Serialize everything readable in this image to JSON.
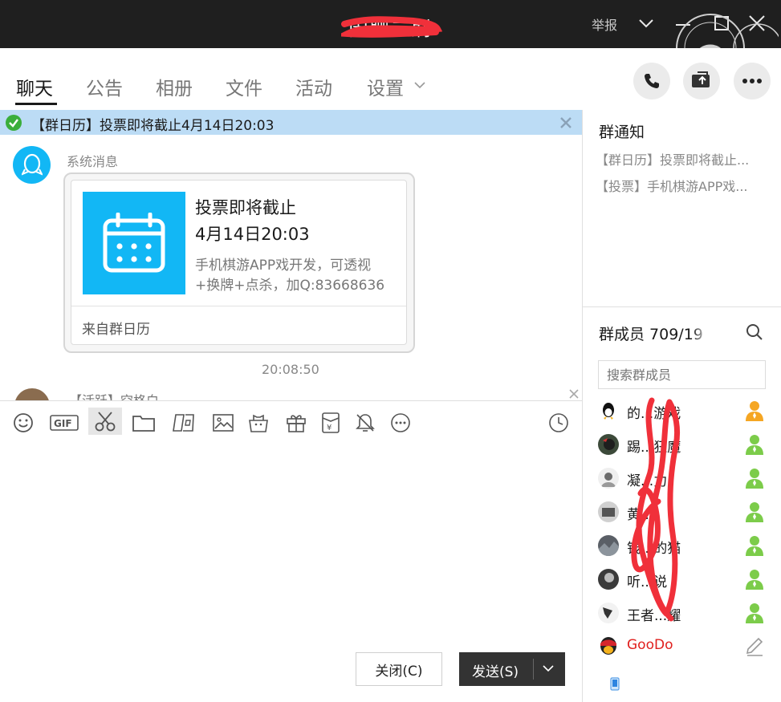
{
  "window": {
    "title": "闲聊二刷",
    "report_label": "举报",
    "window_icons": [
      "chevron-down-icon",
      "minimize-icon",
      "maximize-icon",
      "close-icon"
    ]
  },
  "tabs": [
    {
      "label": "聊天",
      "active": true
    },
    {
      "label": "公告"
    },
    {
      "label": "相册"
    },
    {
      "label": "文件"
    },
    {
      "label": "活动"
    },
    {
      "label": "设置"
    }
  ],
  "header_actions": [
    "phone-icon",
    "share-screen-icon",
    "more-icon"
  ],
  "notice_bar": {
    "text": "【群日历】投票即将截止4月14日20:03"
  },
  "chat": {
    "system_sender": "系统消息",
    "card": {
      "title": "投票即将截止",
      "time": "4月14日20:03",
      "desc_line1": "手机棋游APP戏开发，可透视",
      "desc_line2": "+换牌+点杀，加Q:83668636",
      "source": "来自群日历"
    },
    "message_time": "20:08:50",
    "peek_text": "【活跃】空格白"
  },
  "toolbar": {
    "icons": [
      "emoji-icon",
      "gif-icon",
      "scissors-icon",
      "folder-icon",
      "tiles-icon",
      "image-icon",
      "bag-icon",
      "gift-icon",
      "red-packet-icon",
      "bell-mute-icon",
      "more-circle-icon",
      "clock-icon"
    ],
    "active": "scissors-icon"
  },
  "buttons": {
    "close_label": "关闭(C)",
    "send_label": "发送(S)"
  },
  "right_panel": {
    "notice_title": "群通知",
    "notices": [
      "【群日历】投票即将截止...",
      "【投票】手机棋游APP戏..."
    ],
    "members_title": "群成员 709/19",
    "search_placeholder": "搜索群成员",
    "members": [
      {
        "name": "的...游戏",
        "role_color": "#f5a623"
      },
      {
        "name": "踢...狂魔",
        "role_color": "#7ccc4a"
      },
      {
        "name": "凝...力",
        "role_color": "#7ccc4a"
      },
      {
        "name": "黄...",
        "role_color": "#7ccc4a"
      },
      {
        "name": "钱...的猫",
        "role_color": "#7ccc4a"
      },
      {
        "name": "听...说",
        "role_color": "#7ccc4a"
      },
      {
        "name": "王者...耀",
        "role_color": "#7ccc4a"
      },
      {
        "name": "GooDo",
        "role_color": "#e0201e"
      }
    ]
  },
  "colors": {
    "titlebar": "#1f1f1f",
    "accent_blue": "#12b7f5",
    "notice_bg": "#bcdcf5",
    "scribble_red": "#f0303a"
  }
}
